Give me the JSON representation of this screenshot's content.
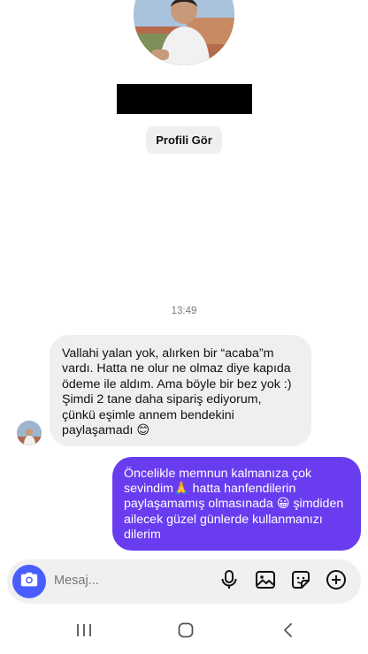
{
  "profile": {
    "button_label": "Profili Gör"
  },
  "thread": {
    "timestamp": "13:49",
    "incoming_text": "Vallahi yalan yok, alırken bir “acaba”m\nvardı. Hatta ne olur ne olmaz diye kapıda\nödeme ile aldım. Ama böyle bir bez yok :)\nŞimdi 2 tane daha sipariş ediyorum,\nçünkü eşimle annem bendekini\npaylaşamadı",
    "incoming_emoji": "😊",
    "outgoing_part1": "Öncelikle memnun kalmanıza çok\nsevindim",
    "outgoing_emoji1": "🙏",
    "outgoing_part2": " hatta hanfendilerin\npaylaşamamış olmasınada ",
    "outgoing_emoji2": "😀",
    "outgoing_part3": " şimdiden\nailecek güzel günlerde kullanmanızı\ndilerim"
  },
  "composer": {
    "placeholder": "Mesaj..."
  },
  "icons": {
    "camera": "camera-icon",
    "microphone": "microphone-icon",
    "gallery": "gallery-icon",
    "sticker": "sticker-icon",
    "add": "add-icon",
    "recents": "recent-apps-icon",
    "home": "home-icon",
    "back": "back-icon"
  },
  "colors": {
    "accent": "#4a5dff",
    "outgoing_bubble": "#6a3cf0",
    "incoming_bubble": "#efefef"
  }
}
